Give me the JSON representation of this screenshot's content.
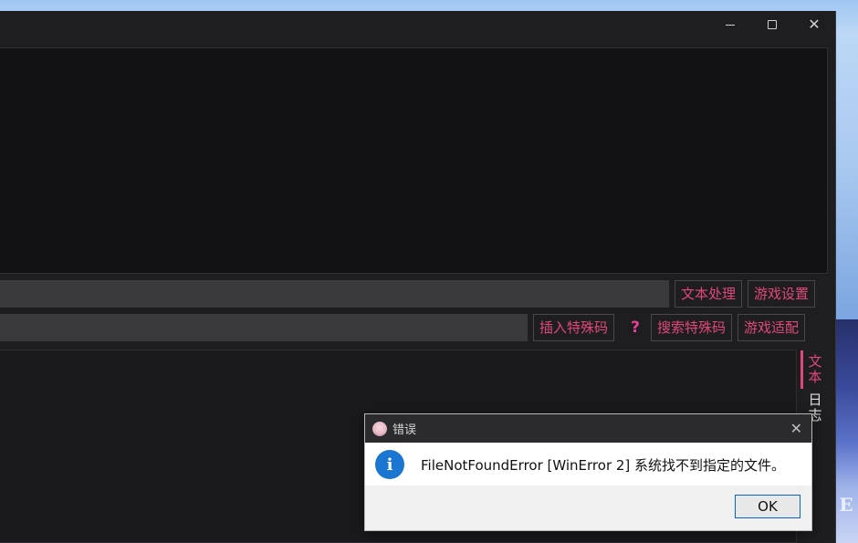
{
  "window": {
    "controls": {
      "minimize_icon": "minimize-icon",
      "maximize_icon": "maximize-icon",
      "close_glyph": "✕"
    }
  },
  "toolbar": {
    "row1": {
      "input_value": "",
      "buttons": [
        "文本处理",
        "游戏设置"
      ]
    },
    "row2": {
      "input_value": "",
      "buttons": [
        "插入特殊码",
        "搜索特殊码",
        "游戏适配"
      ],
      "help_glyph": "?"
    }
  },
  "side_tabs": [
    "文本",
    "日志"
  ],
  "dialog": {
    "title": "错误",
    "close_glyph": "✕",
    "info_glyph": "i",
    "message": "FileNotFoundError [WinError 2] 系统找不到指定的文件。",
    "ok_label": "OK"
  },
  "desktop": {
    "fragment_letter": "E"
  },
  "colors": {
    "accent": "#e0487a",
    "info": "#1b76d2",
    "window_bg": "#1e1e20"
  }
}
